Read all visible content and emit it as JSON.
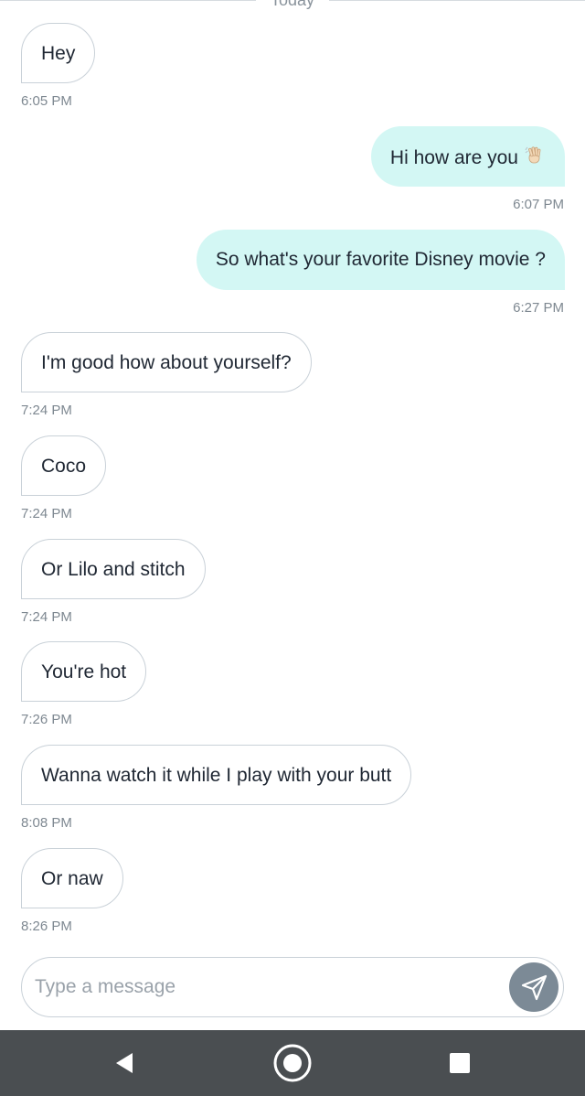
{
  "date_divider": {
    "label": "Today"
  },
  "messages": [
    {
      "direction": "in",
      "text": "Hey",
      "time": "6:05 PM"
    },
    {
      "direction": "out",
      "text": "Hi how are you",
      "emoji": "waving-hand-icon",
      "time": "6:07 PM"
    },
    {
      "direction": "out",
      "text": "So what's your favorite Disney movie ?",
      "time": "6:27 PM"
    },
    {
      "direction": "in",
      "text": "I'm good how about yourself?",
      "time": "7:24 PM"
    },
    {
      "direction": "in",
      "text": "Coco",
      "time": "7:24 PM"
    },
    {
      "direction": "in",
      "text": "Or Lilo and stitch",
      "time": "7:24 PM"
    },
    {
      "direction": "in",
      "text": "You're hot",
      "time": "7:26 PM"
    },
    {
      "direction": "in",
      "text": "Wanna watch it while I play with your butt",
      "time": "8:08 PM"
    },
    {
      "direction": "in",
      "text": "Or naw",
      "time": "8:26 PM"
    }
  ],
  "composer": {
    "placeholder": "Type a message",
    "value": "",
    "send_icon": "paper-plane-icon"
  },
  "navbar": {
    "back_icon": "back-triangle-icon",
    "home_icon": "home-circle-icon",
    "recents_icon": "recents-square-icon"
  },
  "colors": {
    "outgoing_bubble": "#d3f7f4",
    "incoming_border": "#c9d1d8",
    "send_button": "#7c8a96",
    "navbar": "#4a4e51"
  }
}
